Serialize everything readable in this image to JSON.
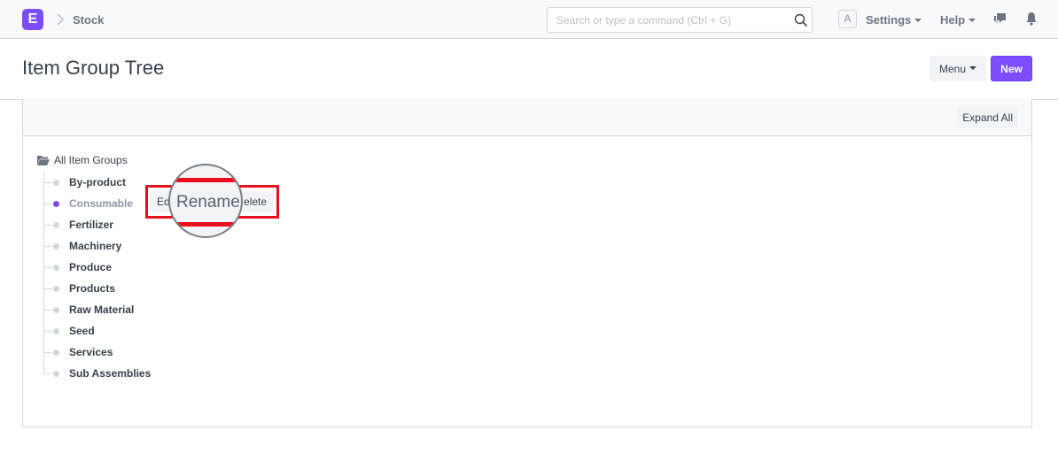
{
  "navbar": {
    "logo_letter": "E",
    "breadcrumb": "Stock",
    "search_placeholder": "Search or type a command (Ctrl + G)",
    "avatar_letter": "A",
    "settings_label": "Settings",
    "help_label": "Help"
  },
  "page": {
    "title": "Item Group Tree",
    "menu_label": "Menu",
    "new_label": "New",
    "accent_color": "#7c4dff"
  },
  "tree": {
    "expand_all_label": "Expand All",
    "root_label": "All Item Groups",
    "nodes": [
      "By-product",
      "Consumable",
      "Fertilizer",
      "Machinery",
      "Produce",
      "Products",
      "Raw Material",
      "Seed",
      "Services",
      "Sub Assemblies"
    ],
    "active_node": "Consumable"
  },
  "node_actions": {
    "edit_fragment": "Ed",
    "delete_fragment": "elete",
    "rename_label": "Rename"
  }
}
